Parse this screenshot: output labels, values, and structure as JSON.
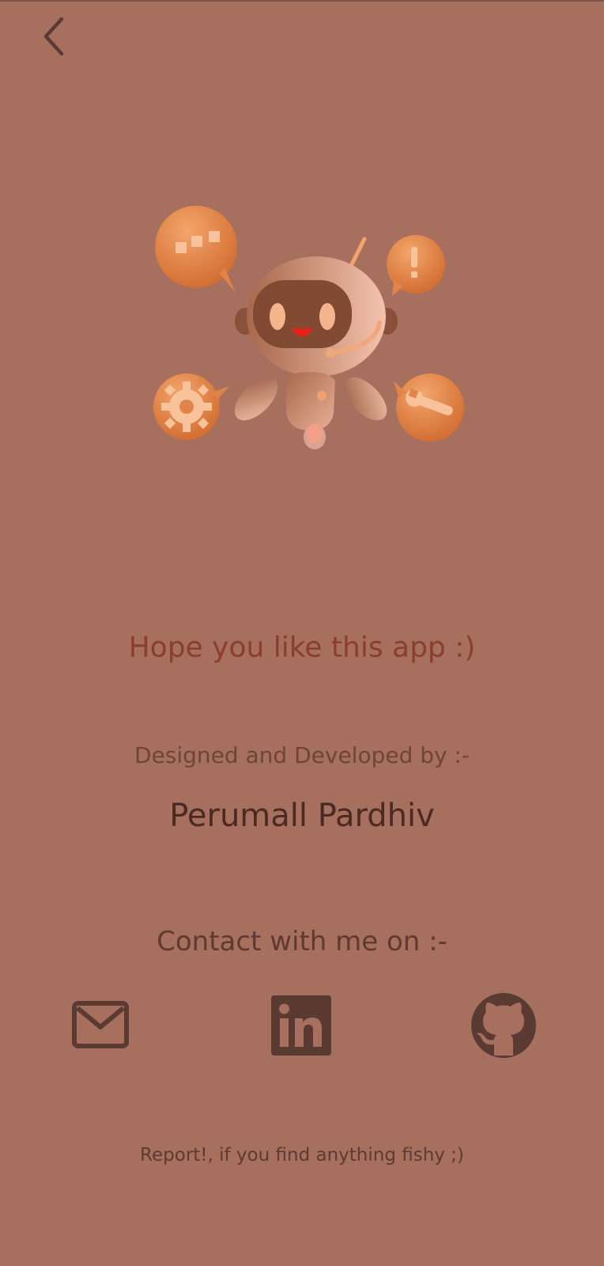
{
  "header": {
    "back_icon": "chevron-left-icon"
  },
  "hero": {
    "illustration": "robot-assistant-icon"
  },
  "content": {
    "hope_text": "Hope you like this app :)",
    "designed_by_label": "Designed and Developed by :-",
    "developer_name": "Perumall Pardhiv",
    "contact_label": "Contact with me on :-",
    "report_text": "Report!, if you find anything fishy ;)"
  },
  "contact_icons": [
    "mail-icon",
    "linkedin-icon",
    "github-icon"
  ],
  "colors": {
    "background": "#a66f5e",
    "accent_text": "#8a3f2c",
    "icon": "#5a3a31",
    "robot_orange": "#e8894f"
  }
}
